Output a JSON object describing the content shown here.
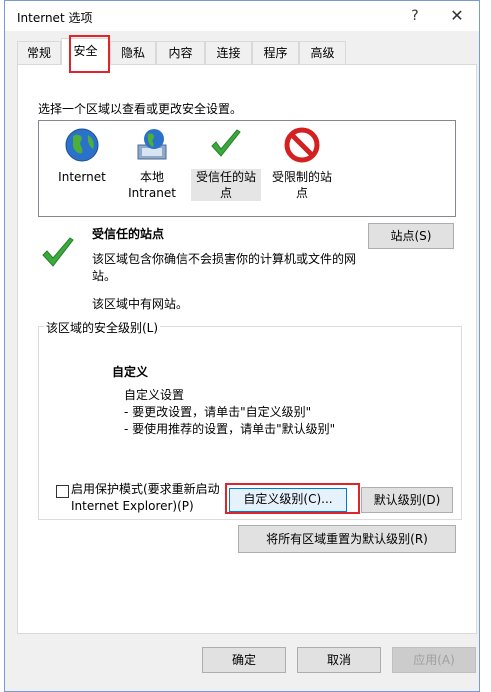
{
  "window": {
    "title": "Internet 选项",
    "help": "?",
    "close": "✕"
  },
  "tabs": [
    "常规",
    "安全",
    "隐私",
    "内容",
    "连接",
    "程序",
    "高级"
  ],
  "prompt": "选择一个区域以查看或更改安全设置。",
  "zones": [
    {
      "line1": "Internet",
      "line2": "",
      "icon": "globe-icon"
    },
    {
      "line1": "本地",
      "line2": "Intranet",
      "icon": "intranet-icon"
    },
    {
      "line1": "受信任的站",
      "line2": "点",
      "icon": "green-check-icon"
    },
    {
      "line1": "受限制的站",
      "line2": "点",
      "icon": "no-entry-icon"
    }
  ],
  "zone_info": {
    "title": "受信任的站点",
    "desc": "该区域包含你确信不会损害你的计算机或文件的网站。",
    "no_sites": "该区域中有网站。",
    "sites_button": "站点(S)"
  },
  "security_level": {
    "group_label": "该区域的安全级别(L)",
    "title": "自定义",
    "lines": [
      "自定义设置",
      "- 要更改设置，请单击\"自定义级别\"",
      "- 要使用推荐的设置，请单击\"默认级别\""
    ],
    "protected_mode_line1": "启用保护模式(要求重新启动",
    "protected_mode_line2": "Internet Explorer)(P)",
    "custom_button": "自定义级别(C)...",
    "default_button": "默认级别(D)"
  },
  "reset_button": "将所有区域重置为默认级别(R)",
  "footer": {
    "ok": "确定",
    "cancel": "取消",
    "apply": "应用(A)"
  },
  "colors": {
    "highlight_red": "#e0242b",
    "focus_blue": "#0078d7"
  }
}
